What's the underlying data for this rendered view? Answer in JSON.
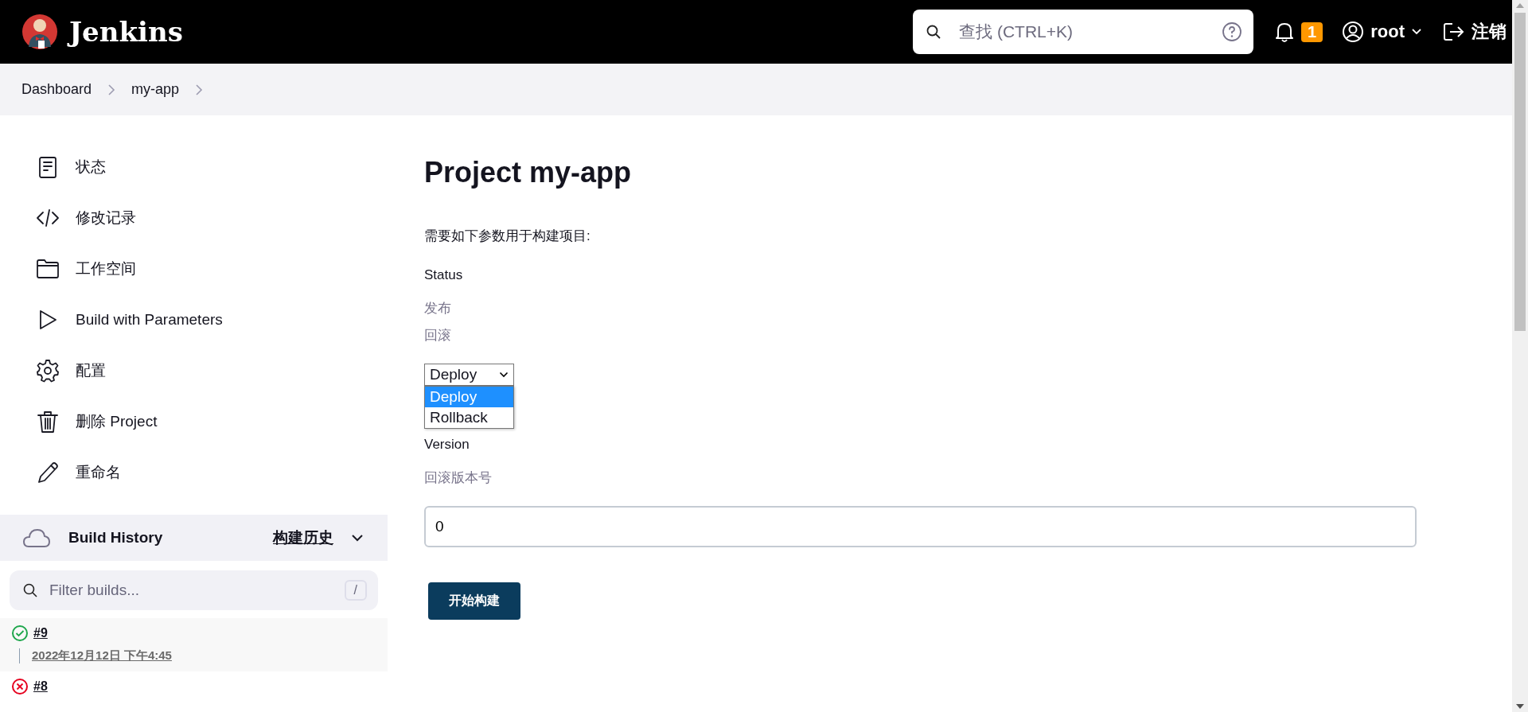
{
  "header": {
    "brand": "Jenkins",
    "search": {
      "placeholder": "查找 (CTRL+K)"
    },
    "notifications": "1",
    "user": "root",
    "logout": "注销"
  },
  "breadcrumbs": [
    "Dashboard",
    "my-app"
  ],
  "sidebar": {
    "items": [
      {
        "kind": "document",
        "label": "状态"
      },
      {
        "kind": "code",
        "label": "修改记录"
      },
      {
        "kind": "folder",
        "label": "工作空间"
      },
      {
        "kind": "play",
        "label": "Build with Parameters"
      },
      {
        "kind": "gear",
        "label": "配置"
      },
      {
        "kind": "trash",
        "label": "删除 Project"
      },
      {
        "kind": "pencil",
        "label": "重命名"
      }
    ]
  },
  "build_history": {
    "title": "Build History",
    "link": "构建历史",
    "filter": {
      "placeholder": "Filter builds...",
      "shortcut": "/"
    },
    "builds": [
      {
        "number": "#9",
        "kind": "success",
        "time": "2022年12月12日 下午4:45"
      },
      {
        "number": "#8",
        "kind": "failure"
      }
    ]
  },
  "main": {
    "title": "Project my-app",
    "description": "需要如下参数用于构建项目:",
    "parameters": [
      {
        "kind": "choice",
        "name": "Status",
        "help": [
          "发布",
          "回滚"
        ],
        "value": "Deploy",
        "expanded": true,
        "options": [
          {
            "label": "Deploy",
            "selected": true
          },
          {
            "label": "Rollback",
            "selected": false
          }
        ]
      },
      {
        "kind": "string",
        "name": "Version",
        "help": [
          "回滚版本号"
        ],
        "value": "0"
      }
    ],
    "submit": "开始构建"
  }
}
